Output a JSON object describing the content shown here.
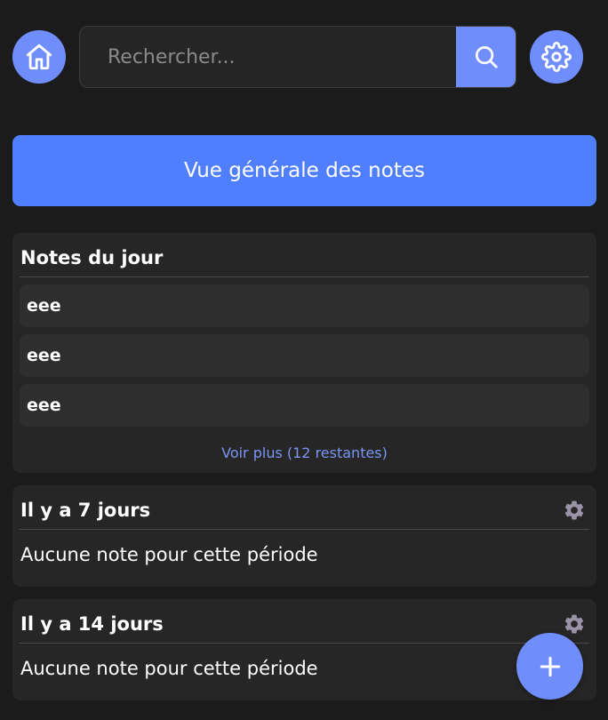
{
  "header": {
    "home_icon": "home-icon",
    "search": {
      "placeholder": "Rechercher...",
      "value": ""
    },
    "search_icon": "search-icon",
    "settings_icon": "gear-icon"
  },
  "overview_button": {
    "label": "Vue générale des notes"
  },
  "today": {
    "title": "Notes du jour",
    "notes": [
      "eee",
      "eee",
      "eee"
    ],
    "more_link": "Voir plus (12 restantes)"
  },
  "sections": [
    {
      "title": "Il y a 7 jours",
      "empty_text": "Aucune note pour cette période",
      "icon": "gear-icon"
    },
    {
      "title": "Il y a 14 jours",
      "empty_text": "Aucune note pour cette période",
      "icon": "gear-icon"
    }
  ],
  "fab": {
    "icon": "plus-icon"
  },
  "colors": {
    "background": "#1b1b1b",
    "accent": "#6f8dfb",
    "primary_button": "#4f7ffd",
    "card": "#262626",
    "link": "#7a95f4",
    "gear_muted": "#9a93a6"
  }
}
